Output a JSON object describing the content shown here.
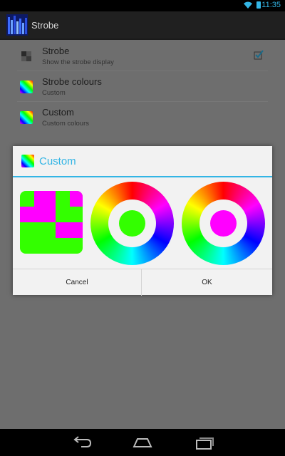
{
  "status_bar": {
    "time": "11:35",
    "icons": [
      "wifi-icon",
      "battery-icon"
    ]
  },
  "action_bar": {
    "title": "Strobe",
    "icon": "strobe-app-icon"
  },
  "preferences": [
    {
      "title": "Strobe",
      "summary": "Show the strobe display",
      "icon": "strobe-small-icon",
      "checked": true
    },
    {
      "title": "Strobe colours",
      "summary": "Custom",
      "icon": "rainbow-gradient-icon"
    },
    {
      "title": "Custom",
      "summary": "Custom colours",
      "icon": "rainbow-gradient-icon"
    }
  ],
  "dialog": {
    "title": "Custom",
    "icon": "rainbow-gradient-icon",
    "preview_colors": {
      "primary": "#33ff00",
      "secondary": "#ff00ff"
    },
    "wheels": [
      {
        "name": "color-1",
        "selected": "#33ff00"
      },
      {
        "name": "color-2",
        "selected": "#ff00ff"
      }
    ],
    "buttons": {
      "cancel": "Cancel",
      "ok": "OK"
    }
  },
  "nav_bar": {
    "buttons": [
      "back-icon",
      "home-icon",
      "recent-apps-icon"
    ]
  },
  "colors": {
    "accent": "#33b5e5",
    "dim_background": "#6e6e6e",
    "dialog_background": "#f2f2f2"
  }
}
